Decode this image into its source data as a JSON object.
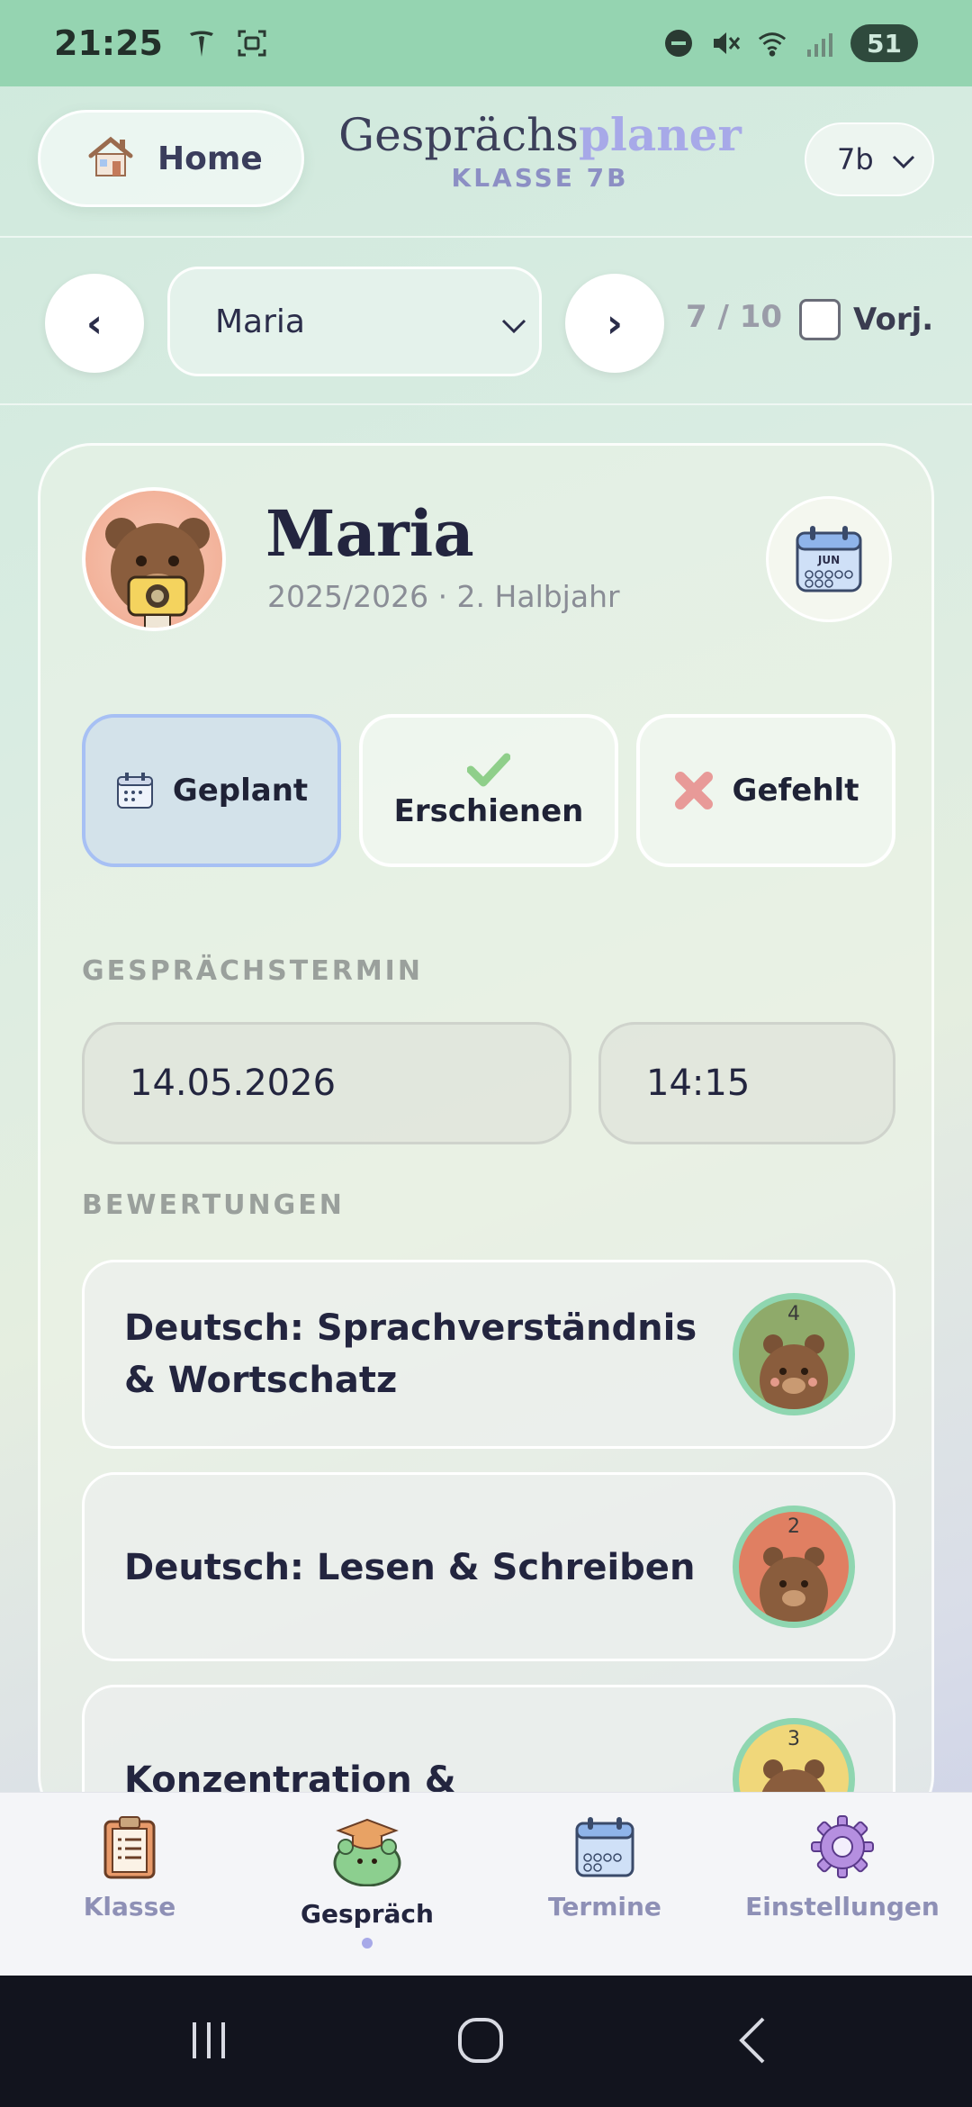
{
  "statusbar": {
    "time": "21:25",
    "battery": "51"
  },
  "header": {
    "home_label": "Home",
    "title_part1": "Gesprächs",
    "title_part2": "planer",
    "subtitle": "KLASSE 7B",
    "class_value": "7b"
  },
  "navigation": {
    "prev": "‹",
    "next": "›",
    "student_value": "Maria",
    "counter": "7 / 10",
    "previous_year_label": "Vorj."
  },
  "student": {
    "name": "Maria",
    "term": "2025/2026 · 2. Halbjahr",
    "calendar_month": "JUN"
  },
  "status_buttons": [
    {
      "label": "Geplant",
      "active": true
    },
    {
      "label": "Erschienen",
      "active": false
    },
    {
      "label": "Gefehlt",
      "active": false
    }
  ],
  "appointment": {
    "section_label": "GESPRÄCHSTERMIN",
    "date": "14.05.2026",
    "time": "14:15"
  },
  "ratings": {
    "section_label": "BEWERTUNGEN",
    "items": [
      {
        "label": "Deutsch: Sprachverständnis & Wortschatz",
        "score": "4",
        "color": "#8faa6a"
      },
      {
        "label": "Deutsch: Lesen & Schreiben",
        "score": "2",
        "color": "#e07f62"
      },
      {
        "label": "Konzentration & Arbeitsweise",
        "score": "3",
        "color": "#f0d77a"
      }
    ]
  },
  "bottom_nav": [
    {
      "label": "Klasse",
      "icon": "clipboard-icon",
      "active": false
    },
    {
      "label": "Gespräch",
      "icon": "bear-graduate-icon",
      "active": true
    },
    {
      "label": "Termine",
      "icon": "calendar-icon",
      "active": false
    },
    {
      "label": "Einstellungen",
      "icon": "gear-icon",
      "active": false
    }
  ],
  "colors": {
    "accent": "#a7a9e8",
    "statusbar": "#95d4b1",
    "active_border": "#a7c0f4",
    "rating_ring": "#8fd6b0"
  }
}
